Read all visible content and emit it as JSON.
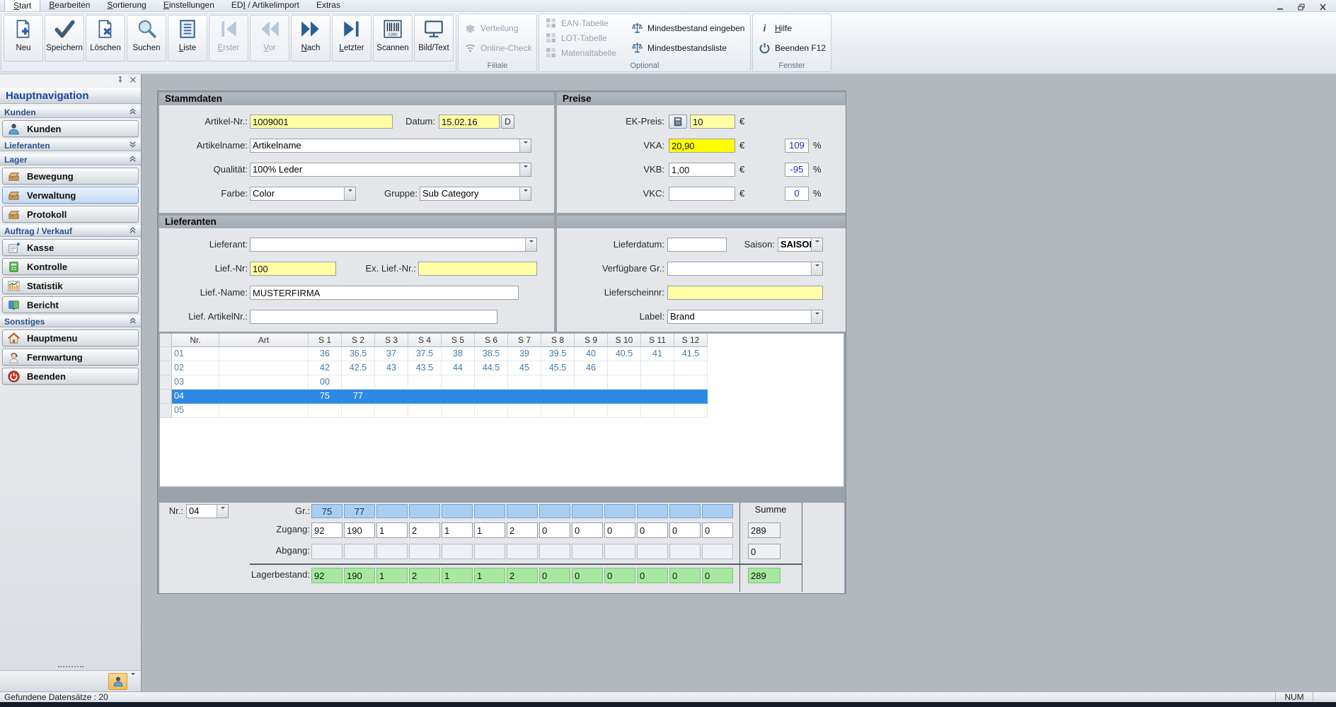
{
  "window": {
    "minimize_label": "minimize",
    "restore_label": "restore",
    "close_label": "close"
  },
  "menubar": {
    "tabs": [
      {
        "label": "Start",
        "accel": 0,
        "selected": true
      },
      {
        "label": "Bearbeiten",
        "accel": 0
      },
      {
        "label": "Sortierung",
        "accel": 0
      },
      {
        "label": "Einstellungen",
        "accel": 0
      },
      {
        "label": "EDI / Artikelimport",
        "accel": 2
      },
      {
        "label": "Extras",
        "accel": -1
      }
    ]
  },
  "ribbon": {
    "main_buttons": [
      {
        "label": "Neu",
        "icon": "doc-new",
        "accel": -1
      },
      {
        "label": "Speichern",
        "icon": "check",
        "accel": -1
      },
      {
        "label": "Löschen",
        "icon": "doc-delete",
        "accel": -1
      },
      {
        "label": "Suchen",
        "icon": "search",
        "accel": -1
      },
      {
        "label": "Liste",
        "icon": "list",
        "accel": 0
      },
      {
        "label": "Erster",
        "icon": "nav-first",
        "accel": 0,
        "disabled": true
      },
      {
        "label": "Vor",
        "icon": "nav-prev",
        "accel": 0,
        "disabled": true
      },
      {
        "label": "Nach",
        "icon": "nav-next",
        "accel": 0
      },
      {
        "label": "Letzter",
        "icon": "nav-last",
        "accel": 0
      },
      {
        "label": "Scannen",
        "icon": "barcode",
        "accel": -1
      },
      {
        "label": "Bild/Text",
        "icon": "monitor",
        "accel": -1
      }
    ],
    "groups": [
      {
        "label": "Filiale",
        "items": [
          {
            "label": "Verteilung",
            "icon": "cube",
            "disabled": true
          },
          {
            "label": "Online-Check",
            "icon": "wifi",
            "disabled": true
          }
        ]
      },
      {
        "label": "Optional",
        "columns": [
          [
            {
              "label": "EAN-Tabelle",
              "icon": "grid-squares",
              "disabled": true
            },
            {
              "label": "LOT-Tabelle",
              "icon": "grid-squares",
              "disabled": true
            },
            {
              "label": "Materialtabelle",
              "icon": "grid-squares",
              "disabled": true
            }
          ],
          [
            {
              "label": "Mindestbestand eingeben",
              "icon": "scale"
            },
            {
              "label": "Mindestbestandsliste",
              "icon": "scale"
            }
          ]
        ]
      },
      {
        "label": "Fenster",
        "items": [
          {
            "label": "Hilfe",
            "icon": "info",
            "accel": 0
          },
          {
            "label": "Beenden F12",
            "icon": "power"
          }
        ]
      }
    ]
  },
  "sidebar": {
    "title": "Hauptnavigation",
    "sections": [
      {
        "label": "Kunden",
        "collapsed": false,
        "items": [
          {
            "label": "Kunden",
            "icon": "person"
          }
        ]
      },
      {
        "label": "Lieferanten",
        "collapsed": true,
        "items": []
      },
      {
        "label": "Lager",
        "collapsed": false,
        "items": [
          {
            "label": "Bewegung",
            "icon": "box"
          },
          {
            "label": "Verwaltung",
            "icon": "box",
            "selected": true
          },
          {
            "label": "Protokoll",
            "icon": "box"
          }
        ]
      },
      {
        "label": "Auftrag / Verkauf",
        "collapsed": false,
        "items": [
          {
            "label": "Kasse",
            "icon": "register"
          },
          {
            "label": "Kontrolle",
            "icon": "calculator"
          },
          {
            "label": "Statistik",
            "icon": "chart"
          },
          {
            "label": "Bericht",
            "icon": "book"
          }
        ]
      },
      {
        "label": "Sonstiges",
        "collapsed": false,
        "items": [
          {
            "label": "Hauptmenu",
            "icon": "house"
          },
          {
            "label": "Fernwartung",
            "icon": "support-person"
          },
          {
            "label": "Beenden",
            "icon": "power-red"
          }
        ]
      }
    ]
  },
  "form": {
    "stammdaten": {
      "title": "Stammdaten",
      "artikel_nr": {
        "label": "Artikel-Nr.:",
        "value": "1009001"
      },
      "datum": {
        "label": "Datum:",
        "value": "15.02.16",
        "button": "D"
      },
      "artikelname": {
        "label": "Artikelname:",
        "value": "Artikelname"
      },
      "qualitaet": {
        "label": "Qualität:",
        "value": "100% Leder"
      },
      "farbe": {
        "label": "Farbe:",
        "value": "Color"
      },
      "gruppe": {
        "label": "Gruppe:",
        "value": "Sub Category"
      }
    },
    "preise": {
      "title": "Preise",
      "currency": "€",
      "percent": "%",
      "ek_preis": {
        "label": "EK-Preis:",
        "value": "10"
      },
      "vka": {
        "label": "VKA:",
        "value": "20,90",
        "pct": "109"
      },
      "vkb": {
        "label": "VKB:",
        "value": "1,00",
        "pct": "-95"
      },
      "vkc": {
        "label": "VKC:",
        "value": "",
        "pct": "0"
      }
    },
    "lieferanten": {
      "title": "Lieferanten",
      "lieferant": {
        "label": "Lieferant:",
        "value": ""
      },
      "lief_nr": {
        "label": "Lief.-Nr:",
        "value": "100"
      },
      "ex_lief_nr": {
        "label": "Ex. Lief.-Nr.:",
        "value": ""
      },
      "lief_name": {
        "label": "Lief.-Name:",
        "value": "MUSTERFIRMA"
      },
      "lief_artikelnr": {
        "label": "Lief. ArtikelNr.:",
        "value": ""
      },
      "lieferdatum": {
        "label": "Lieferdatum:",
        "value": ""
      },
      "saison": {
        "label": "Saison:",
        "value": "SAISON"
      },
      "verfuegbare_gr": {
        "label": "Verfügbare Gr.:",
        "value": ""
      },
      "lieferscheinnr": {
        "label": "Lieferscheinnr:",
        "value": ""
      },
      "label_field": {
        "label": "Label:",
        "value": "Brand"
      }
    }
  },
  "grid": {
    "columns": [
      "Nr.",
      "Art",
      "S 1",
      "S 2",
      "S 3",
      "S 4",
      "S 5",
      "S 6",
      "S 7",
      "S 8",
      "S 9",
      "S 10",
      "S 11",
      "S 12"
    ],
    "rows": [
      {
        "nr": "01",
        "art": "",
        "selected": false,
        "sizes": [
          "36",
          "36.5",
          "37",
          "37.5",
          "38",
          "38.5",
          "39",
          "39.5",
          "40",
          "40.5",
          "41",
          "41.5"
        ]
      },
      {
        "nr": "02",
        "art": "",
        "selected": false,
        "sizes": [
          "42",
          "42.5",
          "43",
          "43.5",
          "44",
          "44.5",
          "45",
          "45.5",
          "46",
          "",
          "",
          ""
        ]
      },
      {
        "nr": "03",
        "art": "",
        "selected": false,
        "sizes": [
          "00",
          "",
          "",
          "",
          "",
          "",
          "",
          "",
          "",
          "",
          "",
          ""
        ]
      },
      {
        "nr": "04",
        "art": "",
        "selected": true,
        "sizes": [
          "75",
          "77",
          "",
          "",
          "",
          "",
          "",
          "",
          "",
          "",
          "",
          ""
        ]
      },
      {
        "nr": "05",
        "art": "",
        "selected": false,
        "sizes": [
          "",
          "",
          "",
          "",
          "",
          "",
          "",
          "",
          "",
          "",
          "",
          ""
        ]
      }
    ]
  },
  "summary": {
    "nr_label": "Nr.:",
    "nr_value": "04",
    "sum_header": "Summe",
    "gr": {
      "label": "Gr.:",
      "values": [
        "75",
        "77",
        "",
        "",
        "",
        "",
        "",
        "",
        "",
        "",
        "",
        "",
        ""
      ]
    },
    "zugang": {
      "label": "Zugang:",
      "values": [
        "92",
        "190",
        "1",
        "2",
        "1",
        "1",
        "2",
        "0",
        "0",
        "0",
        "0",
        "0",
        "0"
      ],
      "sum": "289"
    },
    "abgang": {
      "label": "Abgang:",
      "values": [
        "",
        "",
        "",
        "",
        "",
        "",
        "",
        "",
        "",
        "",
        "",
        "",
        ""
      ],
      "sum": "0"
    },
    "lagerbestand": {
      "label": "Lagerbestand:",
      "values": [
        "92",
        "190",
        "1",
        "2",
        "1",
        "1",
        "2",
        "0",
        "0",
        "0",
        "0",
        "0",
        "0"
      ],
      "sum": "289"
    }
  },
  "statusbar": {
    "left": "Gefundene Datensätze :  20",
    "num": "NUM"
  },
  "colors": {
    "field_yellow": "#ffffa6",
    "field_bright_yellow": "#ffff00",
    "field_cyan": "#c6f5f7",
    "selection_blue": "#2d8ae4",
    "stock_green": "#a6e89f",
    "size_blue": "#a9cef1",
    "percent_text": "#2525c8"
  }
}
